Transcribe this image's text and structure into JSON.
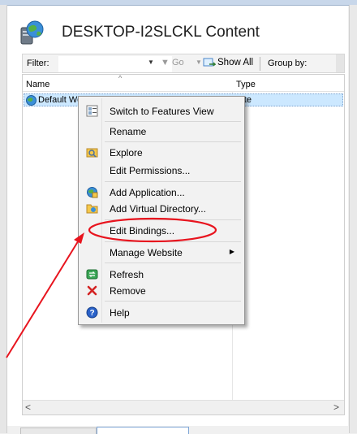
{
  "header": {
    "title": "DESKTOP-I2SLCKL Content"
  },
  "filter_bar": {
    "filter_label": "Filter:",
    "filter_value": "",
    "go_label": "Go",
    "show_all_label": "Show All",
    "group_by_label": "Group by:"
  },
  "list": {
    "columns": [
      "Name",
      "Type"
    ],
    "rows": [
      {
        "name": "Default Web Site",
        "type": "Site"
      }
    ]
  },
  "context_menu": {
    "items": [
      {
        "label": "Switch to Features View",
        "icon": "features-view-icon"
      },
      {
        "label": "Rename",
        "icon": ""
      },
      {
        "label": "Explore",
        "icon": "explore-icon"
      },
      {
        "label": "Edit Permissions...",
        "icon": ""
      },
      {
        "label": "Add Application...",
        "icon": "add-application-icon"
      },
      {
        "label": "Add Virtual Directory...",
        "icon": "add-virtual-directory-icon"
      },
      {
        "label": "Edit Bindings...",
        "icon": "",
        "highlighted": true
      },
      {
        "label": "Manage Website",
        "icon": "",
        "has_submenu": true
      },
      {
        "label": "Refresh",
        "icon": "refresh-icon"
      },
      {
        "label": "Remove",
        "icon": "remove-icon"
      },
      {
        "label": "Help",
        "icon": "help-icon"
      }
    ]
  },
  "colors": {
    "selection": "#cce8ff",
    "annotation": "#e8141e",
    "menu_bg": "#f2f2f2"
  }
}
